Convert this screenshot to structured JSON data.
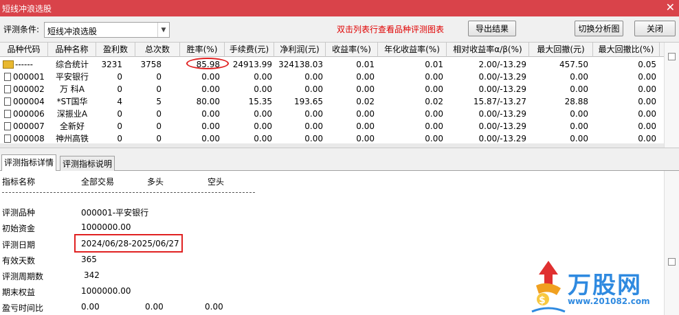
{
  "window": {
    "title": "短线冲浪选股",
    "close_glyph": "✕"
  },
  "toolbar": {
    "condition_label": "评测条件:",
    "condition_value": "短线冲浪选股",
    "hint": "双击列表行查看品种评测图表",
    "export_label": "导出结果",
    "switch_chart_label": "切换分析图",
    "close_label": "关闭"
  },
  "grid": {
    "headers": [
      "品种代码",
      "品种名称",
      "盈利数",
      "总次数",
      "胜率(%)",
      "手续费(元)",
      "净利润(元)",
      "收益率(%)",
      "年化收益率(%)",
      "相对收益率α/β(%)",
      "最大回撤(元)",
      "最大回撤比(%)"
    ],
    "rows": [
      {
        "code": "------",
        "name": "综合统计",
        "win": "3231",
        "total": "3758",
        "rate": "85.98",
        "fee": "24913.99",
        "profit": "324138.03",
        "ret": "0.01",
        "annual": "0.01",
        "rel": "2.00/-13.29",
        "maxdd": "457.50",
        "maxddr": "0.05",
        "icon": "folder-icon"
      },
      {
        "code": "000001",
        "name": "平安银行",
        "win": "0",
        "total": "0",
        "rate": "0.00",
        "fee": "0.00",
        "profit": "0.00",
        "ret": "0.00",
        "annual": "0.00",
        "rel": "0.00/-13.29",
        "maxdd": "0.00",
        "maxddr": "0.00",
        "icon": "document-icon"
      },
      {
        "code": "000002",
        "name": "万 科A",
        "win": "0",
        "total": "0",
        "rate": "0.00",
        "fee": "0.00",
        "profit": "0.00",
        "ret": "0.00",
        "annual": "0.00",
        "rel": "0.00/-13.29",
        "maxdd": "0.00",
        "maxddr": "0.00",
        "icon": "document-icon"
      },
      {
        "code": "000004",
        "name": "*ST国华",
        "win": "4",
        "total": "5",
        "rate": "80.00",
        "fee": "15.35",
        "profit": "193.65",
        "ret": "0.02",
        "annual": "0.02",
        "rel": "15.87/-13.27",
        "maxdd": "28.88",
        "maxddr": "0.00",
        "icon": "document-icon"
      },
      {
        "code": "000006",
        "name": "深振业A",
        "win": "0",
        "total": "0",
        "rate": "0.00",
        "fee": "0.00",
        "profit": "0.00",
        "ret": "0.00",
        "annual": "0.00",
        "rel": "0.00/-13.29",
        "maxdd": "0.00",
        "maxddr": "0.00",
        "icon": "document-icon"
      },
      {
        "code": "000007",
        "name": "全新好",
        "win": "0",
        "total": "0",
        "rate": "0.00",
        "fee": "0.00",
        "profit": "0.00",
        "ret": "0.00",
        "annual": "0.00",
        "rel": "0.00/-13.29",
        "maxdd": "0.00",
        "maxddr": "0.00",
        "icon": "document-icon"
      },
      {
        "code": "000008",
        "name": "神州高铁",
        "win": "0",
        "total": "0",
        "rate": "0.00",
        "fee": "0.00",
        "profit": "0.00",
        "ret": "0.00",
        "annual": "0.00",
        "rel": "0.00/-13.29",
        "maxdd": "0.00",
        "maxddr": "0.00",
        "icon": "document-icon"
      }
    ]
  },
  "tabs": [
    {
      "label": "评测指标详情",
      "active": true
    },
    {
      "label": "评测指标说明",
      "active": false
    }
  ],
  "detail": {
    "headers": [
      "指标名称",
      "全部交易",
      "多头",
      "空头"
    ],
    "items": [
      {
        "label": "评测品种",
        "all": "000001-平安银行",
        "long": "",
        "short": ""
      },
      {
        "label": "初始资金",
        "all": "1000000.00",
        "long": "",
        "short": ""
      },
      {
        "label": "评测日期",
        "all": "2024/06/28-2025/06/27",
        "long": "",
        "short": ""
      },
      {
        "label": "有效天数",
        "all": "365",
        "long": "",
        "short": ""
      },
      {
        "label": "评测周期数",
        "all": "342",
        "long": "",
        "short": ""
      },
      {
        "label": "期末权益",
        "all": "1000000.00",
        "long": "",
        "short": ""
      },
      {
        "label": "盈亏时间比",
        "all": "0.00",
        "long": "0.00",
        "short": "0.00"
      }
    ]
  },
  "watermark": {
    "brand": "万股网",
    "url": "www.201082.com"
  },
  "colors": {
    "titlebar": "#d9434a",
    "hint": "#e00000",
    "highlight": "#e02020",
    "brand": "#2f8ae0"
  }
}
